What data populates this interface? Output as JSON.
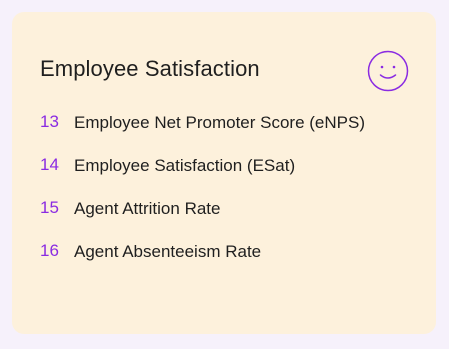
{
  "card": {
    "title": "Employee Satisfaction",
    "icon": "smiley-face-icon",
    "accent_color": "#8a2be2",
    "background_color": "#fdf1dc",
    "items": [
      {
        "number": "13",
        "label": "Employee Net Promoter Score (eNPS)"
      },
      {
        "number": "14",
        "label": "Employee Satisfaction (ESat)"
      },
      {
        "number": "15",
        "label": "Agent Attrition Rate"
      },
      {
        "number": "16",
        "label": "Agent Absenteeism Rate"
      }
    ]
  }
}
